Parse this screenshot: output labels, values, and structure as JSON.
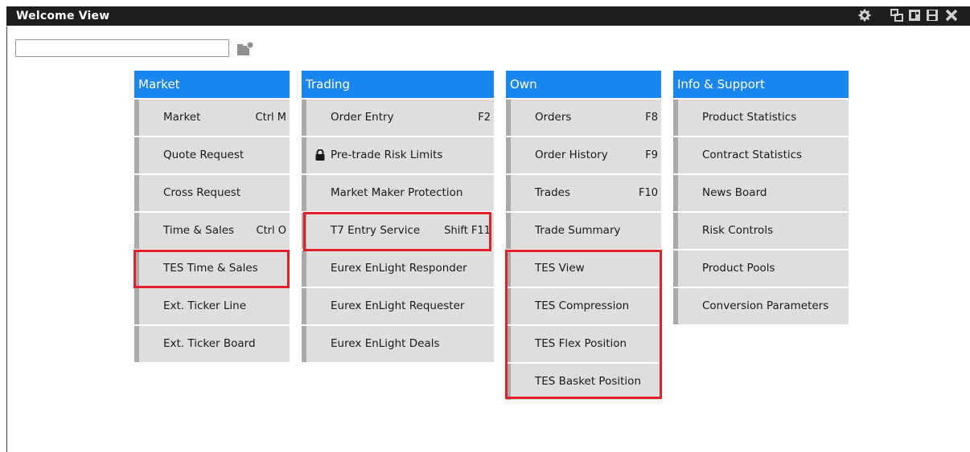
{
  "window": {
    "title": "Welcome View",
    "title_bar_icons": [
      "gear-icon",
      "tile-windows-icon",
      "restore-window-icon",
      "save-icon",
      "close-icon"
    ]
  },
  "search": {
    "value": "",
    "placeholder": ""
  },
  "columns": {
    "market": {
      "header": "Market",
      "items": [
        {
          "label": "Market",
          "shortcut": "Ctrl M"
        },
        {
          "label": "Quote Request",
          "shortcut": ""
        },
        {
          "label": "Cross Request",
          "shortcut": ""
        },
        {
          "label": "Time & Sales",
          "shortcut": "Ctrl O"
        },
        {
          "label": "TES Time & Sales",
          "shortcut": ""
        },
        {
          "label": "Ext. Ticker Line",
          "shortcut": ""
        },
        {
          "label": "Ext. Ticker Board",
          "shortcut": ""
        }
      ]
    },
    "trading": {
      "header": "Trading",
      "items": [
        {
          "label": "Order Entry",
          "shortcut": "F2"
        },
        {
          "label": "Pre-trade Risk Limits",
          "shortcut": "",
          "icon": "lock-icon"
        },
        {
          "label": "Market Maker Protection",
          "shortcut": ""
        },
        {
          "label": "T7 Entry Service",
          "shortcut": "Shift F11"
        },
        {
          "label": "Eurex EnLight Responder",
          "shortcut": ""
        },
        {
          "label": "Eurex EnLight Requester",
          "shortcut": ""
        },
        {
          "label": "Eurex EnLight Deals",
          "shortcut": ""
        }
      ]
    },
    "own": {
      "header": "Own",
      "items": [
        {
          "label": "Orders",
          "shortcut": "F8"
        },
        {
          "label": "Order History",
          "shortcut": "F9"
        },
        {
          "label": "Trades",
          "shortcut": "F10"
        },
        {
          "label": "Trade Summary",
          "shortcut": ""
        },
        {
          "label": "TES View",
          "shortcut": ""
        },
        {
          "label": "TES Compression",
          "shortcut": ""
        },
        {
          "label": "TES Flex Position",
          "shortcut": ""
        },
        {
          "label": "TES Basket Position",
          "shortcut": ""
        }
      ]
    },
    "info": {
      "header": "Info & Support",
      "items": [
        {
          "label": "Product Statistics",
          "shortcut": ""
        },
        {
          "label": "Contract Statistics",
          "shortcut": ""
        },
        {
          "label": "News Board",
          "shortcut": ""
        },
        {
          "label": "Risk Controls",
          "shortcut": ""
        },
        {
          "label": "Product Pools",
          "shortcut": ""
        },
        {
          "label": "Conversion Parameters",
          "shortcut": ""
        }
      ]
    }
  },
  "colors": {
    "header_blue": "#1a86f0",
    "item_bg": "#dedede",
    "highlight_red": "#e0202a",
    "title_bar": "#1e1e1e"
  }
}
